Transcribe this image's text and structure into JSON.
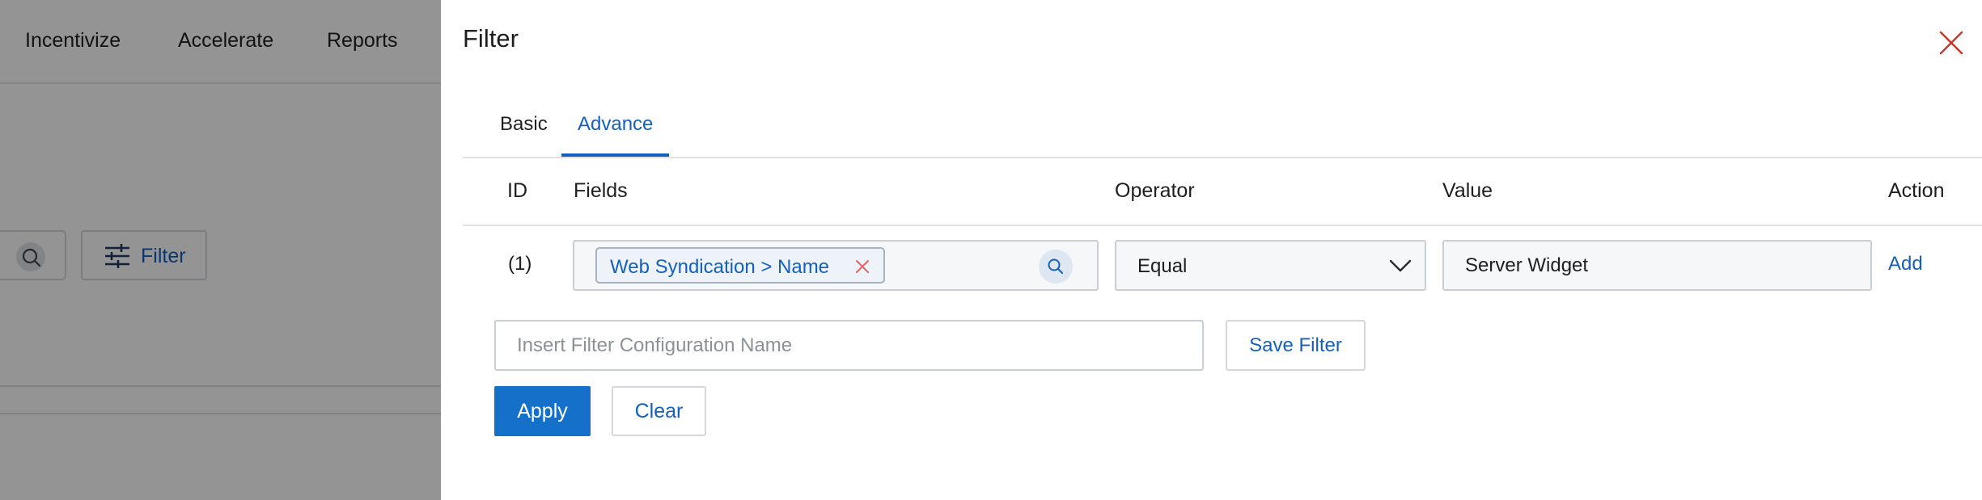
{
  "background": {
    "nav_items": [
      "Incentivize",
      "Accelerate",
      "Reports"
    ],
    "filter_button_label": "Filter"
  },
  "drawer": {
    "title": "Filter",
    "tabs": [
      {
        "label": "Basic",
        "active": false
      },
      {
        "label": "Advance",
        "active": true
      }
    ],
    "columns": [
      "ID",
      "Fields",
      "Operator",
      "Value",
      "Action"
    ],
    "rows": [
      {
        "id": "(1)",
        "field_chip": "Web Syndication > Name",
        "operator": "Equal",
        "value": "Server Widget",
        "action": "Add"
      }
    ],
    "config_name_placeholder": "Insert Filter Configuration Name",
    "save_filter_label": "Save Filter",
    "apply_label": "Apply",
    "clear_label": "Clear"
  },
  "colors": {
    "accent": "#1560bd",
    "primary_button": "#1570c9",
    "close_icon": "#c0392b",
    "overlay": "rgba(0,0,0,0.42)"
  },
  "icons": {
    "close": "close-icon",
    "search": "search-icon",
    "chip_remove": "remove-chip-icon",
    "dropdown": "chevron-down-icon",
    "filter": "sliders-icon"
  }
}
